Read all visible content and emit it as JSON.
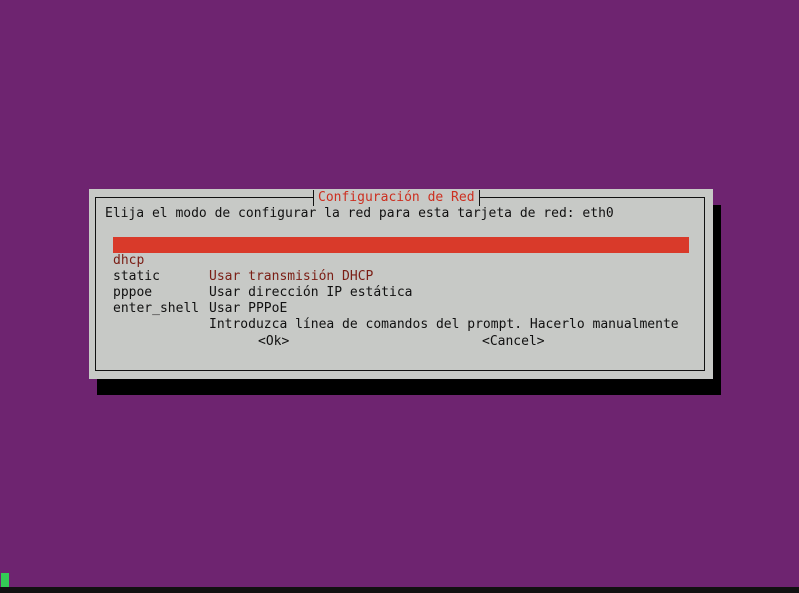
{
  "dialog": {
    "title": "Configuración de Red",
    "prompt": "Elija el modo de configurar la red para esta tarjeta de red: eth0",
    "items": [
      {
        "key": "dhcp",
        "desc": "Usar transmisión DHCP"
      },
      {
        "key": "static",
        "desc": "Usar dirección IP estática"
      },
      {
        "key": "pppoe",
        "desc": "Usar PPPoE"
      },
      {
        "key": "enter_shell",
        "desc": "Introduzca línea de comandos del prompt. Hacerlo manualmente"
      }
    ],
    "selected_index": 0,
    "ok_label": "<Ok>",
    "cancel_label": "<Cancel>"
  },
  "colors": {
    "background": "#6e2470",
    "dialog": "#c7c9c6",
    "title": "#cc2f20",
    "selection": "#d93a2a",
    "cursor": "#33cc55"
  }
}
